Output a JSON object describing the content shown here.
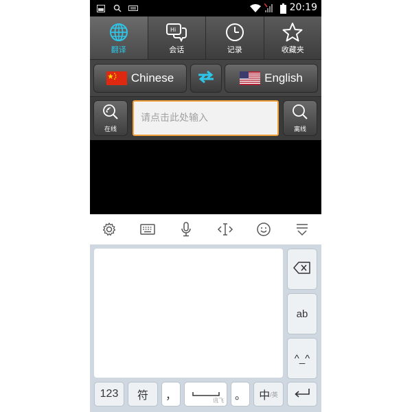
{
  "status_bar": {
    "time": "20:19"
  },
  "tabs": [
    {
      "label": "翻译",
      "icon": "globe-icon",
      "active": true
    },
    {
      "label": "会话",
      "icon": "chat-bubble-icon"
    },
    {
      "label": "记录",
      "icon": "clock-icon"
    },
    {
      "label": "收藏夹",
      "icon": "star-icon"
    }
  ],
  "languages": {
    "source": "Chinese",
    "target": "English"
  },
  "search": {
    "placeholder": "请点击此处输入",
    "online_label": "在线",
    "offline_label": "离线"
  },
  "keyboard": {
    "key_numbers": "123",
    "key_symbols": "符",
    "key_comma": "，",
    "key_space_brand": "讯飞",
    "key_period": "。",
    "key_lang_cn": "中",
    "key_lang_en": "/英",
    "key_ab": "ab",
    "key_emoticon": "^_^"
  },
  "colors": {
    "accent": "#2ec6e8",
    "input_border": "#f1a13b"
  }
}
